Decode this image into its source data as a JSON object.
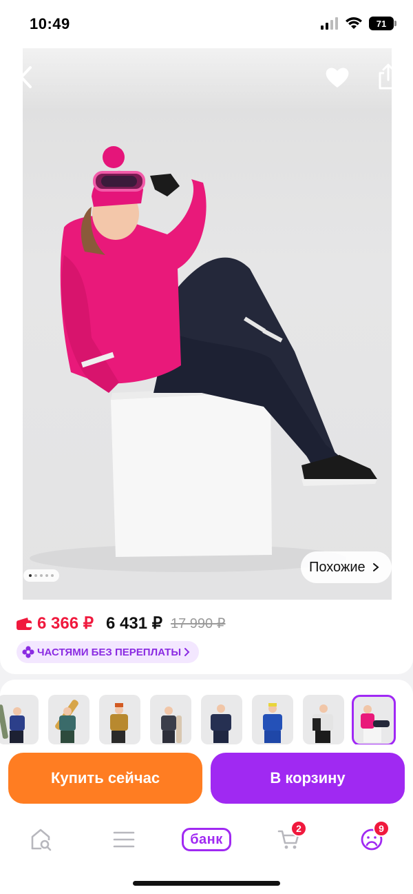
{
  "status_bar": {
    "time": "10:49",
    "battery": "71"
  },
  "header": {
    "back_icon": "chevron-left-icon",
    "favorite_icon": "heart-icon",
    "share_icon": "share-icon"
  },
  "gallery": {
    "similar_label": "Похожие",
    "image_count": 5,
    "active_index": 0
  },
  "price": {
    "wallet_price": "6 366 ₽",
    "current_price": "6 431 ₽",
    "old_price": "17 990 ₽",
    "installment_label": "ЧАСТЯМИ БЕЗ ПЕРЕПЛАТЫ",
    "colors": {
      "wallet": "#f0193d",
      "accent": "#a029f2"
    }
  },
  "variants": {
    "count": 8,
    "selected_index": 7
  },
  "actions": {
    "buy_now_label": "Купить сейчас",
    "add_to_cart_label": "В корзину",
    "buy_now_color": "#ff7d22",
    "cart_color": "#a029f2"
  },
  "bottom_nav": {
    "items": [
      {
        "icon": "home-search-icon"
      },
      {
        "icon": "catalog-menu-icon"
      },
      {
        "icon": "bank-icon",
        "label": "банк"
      },
      {
        "icon": "cart-icon",
        "badge": "2"
      },
      {
        "icon": "profile-icon",
        "badge": "9"
      }
    ]
  }
}
